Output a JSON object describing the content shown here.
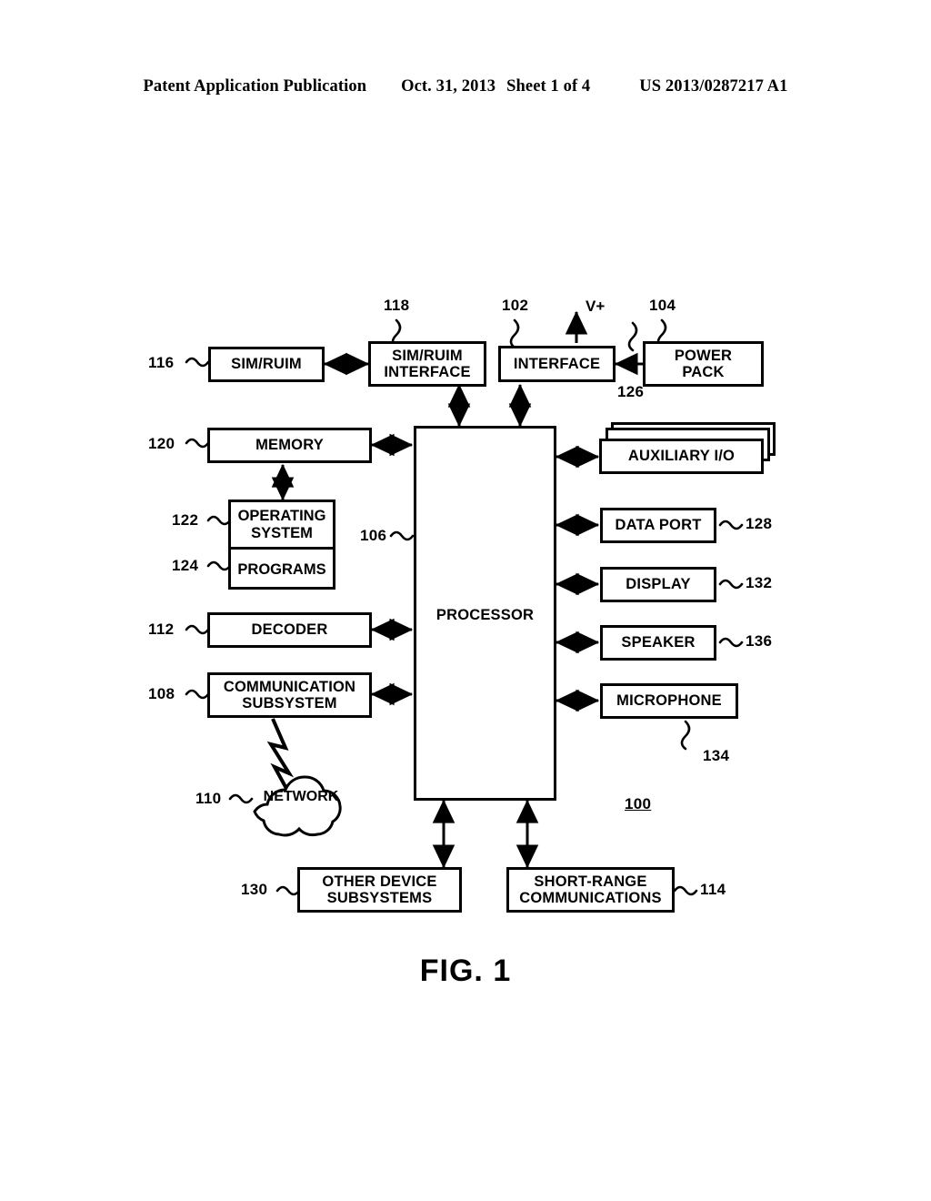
{
  "header": {
    "publication": "Patent Application Publication",
    "date": "Oct. 31, 2013",
    "sheet": "Sheet 1 of 4",
    "patent_number": "US 2013/0287217 A1"
  },
  "figure": {
    "caption": "FIG. 1",
    "system_ref": "100",
    "power_rail_label": "V+"
  },
  "blocks": {
    "sim_ruim": {
      "label": "SIM/RUIM",
      "ref": "116"
    },
    "sim_interface": {
      "label": "SIM/RUIM\nINTERFACE",
      "ref": "118"
    },
    "interface": {
      "label": "INTERFACE",
      "ref": "102"
    },
    "power_pack": {
      "label": "POWER\nPACK",
      "ref": "104"
    },
    "memory": {
      "label": "MEMORY",
      "ref": "120"
    },
    "operating_system": {
      "label": "OPERATING\nSYSTEM",
      "ref": "122"
    },
    "programs": {
      "label": "PROGRAMS",
      "ref": "124"
    },
    "processor": {
      "label": "PROCESSOR",
      "ref": "106"
    },
    "decoder": {
      "label": "DECODER",
      "ref": "112"
    },
    "communication_subsystem": {
      "label": "COMMUNICATION\nSUBSYSTEM",
      "ref": "108"
    },
    "network": {
      "label": "NETWORK",
      "ref": "110"
    },
    "auxiliary_io": {
      "label": "AUXILIARY I/O",
      "ref": "126"
    },
    "data_port": {
      "label": "DATA PORT",
      "ref": "128"
    },
    "display": {
      "label": "DISPLAY",
      "ref": "132"
    },
    "speaker": {
      "label": "SPEAKER",
      "ref": "136"
    },
    "microphone": {
      "label": "MICROPHONE",
      "ref": "134"
    },
    "other_device_subsystems": {
      "label": "OTHER DEVICE\nSUBSYSTEMS",
      "ref": "130"
    },
    "short_range_communications": {
      "label": "SHORT-RANGE\nCOMMUNICATIONS",
      "ref": "114"
    }
  },
  "colors": {
    "ink": "#000000",
    "paper": "#ffffff"
  }
}
